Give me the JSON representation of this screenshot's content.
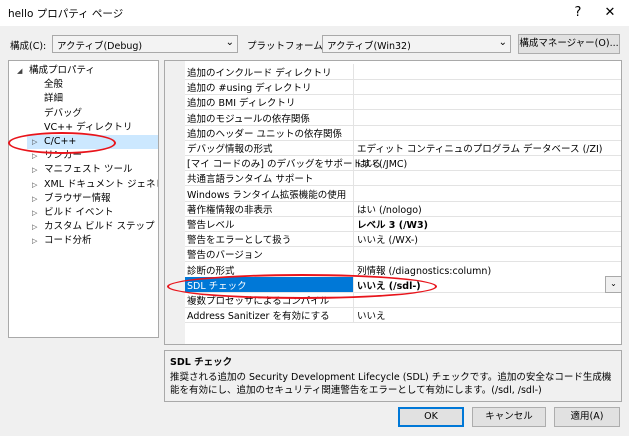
{
  "window": {
    "title": "hello プロパティ ページ",
    "help": "?",
    "close": "✕"
  },
  "config": {
    "label": "構成(C):",
    "value": "アクティブ(Debug)"
  },
  "platform": {
    "label": "プラットフォーム(P):",
    "value": "アクティブ(Win32)"
  },
  "config_manager": "構成マネージャー(O)...",
  "tree": [
    {
      "label": "構成プロパティ",
      "level": 0,
      "expanded": true
    },
    {
      "label": "全般",
      "level": 1
    },
    {
      "label": "詳細",
      "level": 1
    },
    {
      "label": "デバッグ",
      "level": 1
    },
    {
      "label": "VC++ ディレクトリ",
      "level": 1
    },
    {
      "label": "C/C++",
      "level": 1,
      "collapsed": true,
      "selected": true
    },
    {
      "label": "リンカー",
      "level": 1,
      "collapsed": true
    },
    {
      "label": "マニフェスト ツール",
      "level": 1,
      "collapsed": true
    },
    {
      "label": "XML ドキュメント ジェネレーター",
      "level": 1,
      "collapsed": true
    },
    {
      "label": "ブラウザー情報",
      "level": 1,
      "collapsed": true
    },
    {
      "label": "ビルド イベント",
      "level": 1,
      "collapsed": true
    },
    {
      "label": "カスタム ビルド ステップ",
      "level": 1,
      "collapsed": true
    },
    {
      "label": "コード分析",
      "level": 1,
      "collapsed": true
    }
  ],
  "props": [
    {
      "key": "追加のインクルード ディレクトリ",
      "value": ""
    },
    {
      "key": "追加の #using ディレクトリ",
      "value": ""
    },
    {
      "key": "追加の BMI ディレクトリ",
      "value": ""
    },
    {
      "key": "追加のモジュールの依存関係",
      "value": ""
    },
    {
      "key": "追加のヘッダー ユニットの依存関係",
      "value": ""
    },
    {
      "key": "デバッグ情報の形式",
      "value": "エディット コンティニュのプログラム データベース (/ZI)"
    },
    {
      "key": "[マイ コードのみ] のデバッグをサポートする",
      "value": "はい (/JMC)"
    },
    {
      "key": "共通言語ランタイム サポート",
      "value": ""
    },
    {
      "key": "Windows ランタイム拡張機能の使用",
      "value": ""
    },
    {
      "key": "著作権情報の非表示",
      "value": "はい (/nologo)"
    },
    {
      "key": "警告レベル",
      "value": "レベル 3 (/W3)",
      "bold": true
    },
    {
      "key": "警告をエラーとして扱う",
      "value": "いいえ (/WX-)"
    },
    {
      "key": "警告のバージョン",
      "value": ""
    },
    {
      "key": "診断の形式",
      "value": "列情報 (/diagnostics:column)"
    },
    {
      "key": "SDL チェック",
      "value": "いいえ (/sdl-)",
      "selected": true
    },
    {
      "key": "複数プロセッサによるコンパイル",
      "value": ""
    },
    {
      "key": "Address Sanitizer を有効にする",
      "value": "いいえ"
    }
  ],
  "description": {
    "title": "SDL チェック",
    "text": "推奨される追加の Security Development Lifecycle (SDL) チェックです。追加の安全なコード生成機能を有効にし、追加のセキュリティ関連警告をエラーとして有効にします。(/sdl, /sdl-)"
  },
  "buttons": {
    "ok": "OK",
    "cancel": "キャンセル",
    "apply": "適用(A)"
  },
  "colors": {
    "selection": "#0078d7",
    "highlight_ring": "#e8141b"
  }
}
